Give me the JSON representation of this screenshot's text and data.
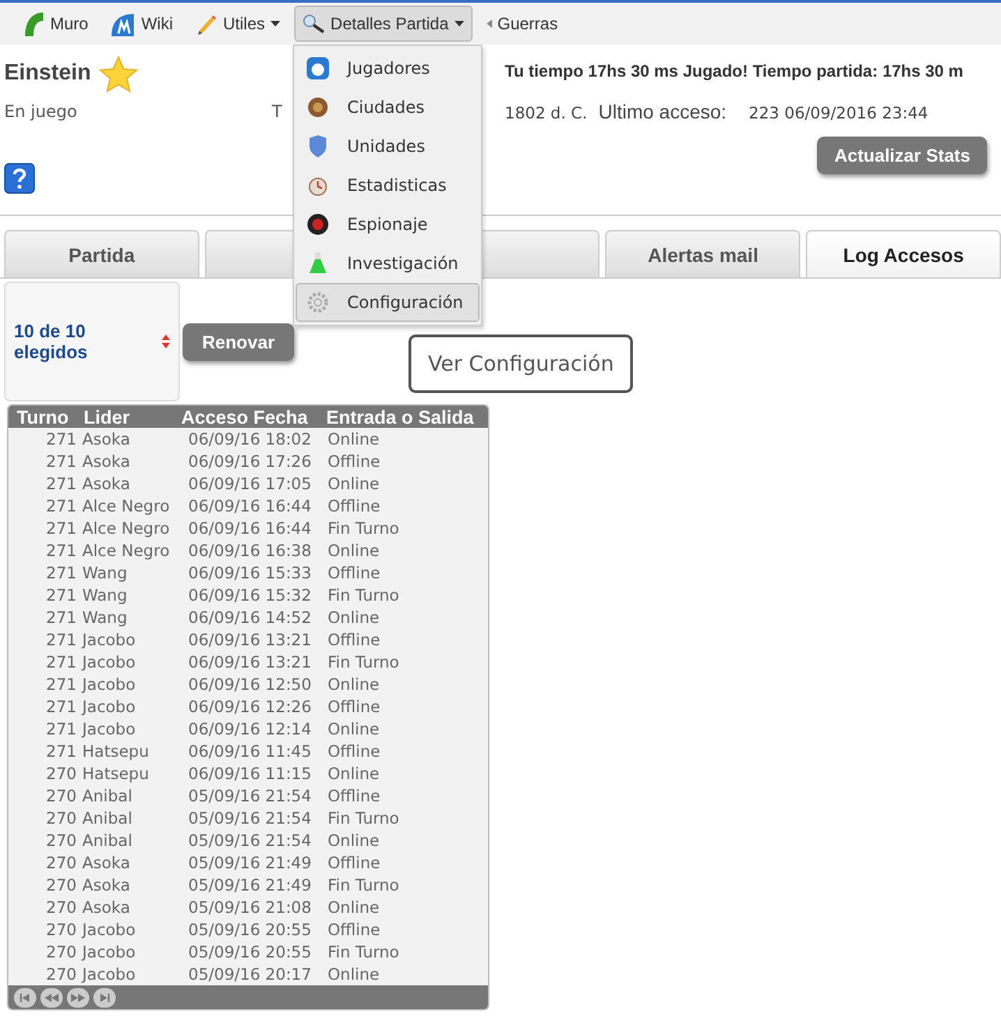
{
  "nav": {
    "items": [
      {
        "label": "Muro",
        "caret": false,
        "selected": false
      },
      {
        "label": "Wiki",
        "caret": false,
        "selected": false
      },
      {
        "label": "Utiles",
        "caret": true,
        "selected": false
      },
      {
        "label": "Detalles Partida",
        "caret": true,
        "selected": true
      },
      {
        "label": "Guerras",
        "caret": false,
        "selected": false
      }
    ]
  },
  "player": {
    "name": "Einstein",
    "status": "En juego",
    "cut_label": "T",
    "time_info": "Tu tiempo 17hs 30 ms Jugado! Tiempo partida: 17hs 30 m",
    "year": "1802 d. C.",
    "last_access_label": "Ultimo acceso:",
    "last_access_value": "223 06/09/2016 23:44"
  },
  "update_button": "Actualizar Stats",
  "tabs": [
    {
      "label": "Partida",
      "selected": false
    },
    {
      "selected": false
    },
    {
      "selected": false
    },
    {
      "label": "Alertas mail",
      "selected": false
    },
    {
      "label": "Log Accesos",
      "selected": true
    }
  ],
  "dropdown": {
    "items": [
      {
        "label": "Jugadores",
        "selected": false
      },
      {
        "label": "Ciudades",
        "selected": false
      },
      {
        "label": "Unidades",
        "selected": false
      },
      {
        "label": "Estadisticas",
        "selected": false
      },
      {
        "label": "Espionaje",
        "selected": false
      },
      {
        "label": "Investigación",
        "selected": false
      },
      {
        "label": "Configuración",
        "selected": true
      }
    ]
  },
  "filter": {
    "value": "10 de 10 elegidos"
  },
  "renew_button": "Renovar",
  "tooltip": "Ver Configuración",
  "table": {
    "columns": [
      "Turno",
      "Lider",
      "Acceso Fecha",
      "Entrada o Salida"
    ],
    "rows": [
      [
        "271",
        "Asoka",
        "06/09/16 18:02",
        "Online"
      ],
      [
        "271",
        "Asoka",
        "06/09/16 17:26",
        "Offline"
      ],
      [
        "271",
        "Asoka",
        "06/09/16 17:05",
        "Online"
      ],
      [
        "271",
        "Alce Negro",
        "06/09/16 16:44",
        "Offline"
      ],
      [
        "271",
        "Alce Negro",
        "06/09/16 16:44",
        "Fin Turno"
      ],
      [
        "271",
        "Alce Negro",
        "06/09/16 16:38",
        "Online"
      ],
      [
        "271",
        "Wang",
        "06/09/16 15:33",
        "Offline"
      ],
      [
        "271",
        "Wang",
        "06/09/16 15:32",
        "Fin Turno"
      ],
      [
        "271",
        "Wang",
        "06/09/16 14:52",
        "Online"
      ],
      [
        "271",
        "Jacobo",
        "06/09/16 13:21",
        "Offline"
      ],
      [
        "271",
        "Jacobo",
        "06/09/16 13:21",
        "Fin Turno"
      ],
      [
        "271",
        "Jacobo",
        "06/09/16 12:50",
        "Online"
      ],
      [
        "271",
        "Jacobo",
        "06/09/16 12:26",
        "Offline"
      ],
      [
        "271",
        "Jacobo",
        "06/09/16 12:14",
        "Online"
      ],
      [
        "271",
        "Hatsepu",
        "06/09/16 11:45",
        "Offline"
      ],
      [
        "270",
        "Hatsepu",
        "06/09/16 11:15",
        "Online"
      ],
      [
        "270",
        "Anibal",
        "05/09/16 21:54",
        "Offline"
      ],
      [
        "270",
        "Anibal",
        "05/09/16 21:54",
        "Fin Turno"
      ],
      [
        "270",
        "Anibal",
        "05/09/16 21:54",
        "Online"
      ],
      [
        "270",
        "Asoka",
        "05/09/16 21:49",
        "Offline"
      ],
      [
        "270",
        "Asoka",
        "05/09/16 21:49",
        "Fin Turno"
      ],
      [
        "270",
        "Asoka",
        "05/09/16 21:08",
        "Online"
      ],
      [
        "270",
        "Jacobo",
        "05/09/16 20:55",
        "Offline"
      ],
      [
        "270",
        "Jacobo",
        "05/09/16 20:55",
        "Fin Turno"
      ],
      [
        "270",
        "Jacobo",
        "05/09/16 20:17",
        "Online"
      ]
    ]
  }
}
